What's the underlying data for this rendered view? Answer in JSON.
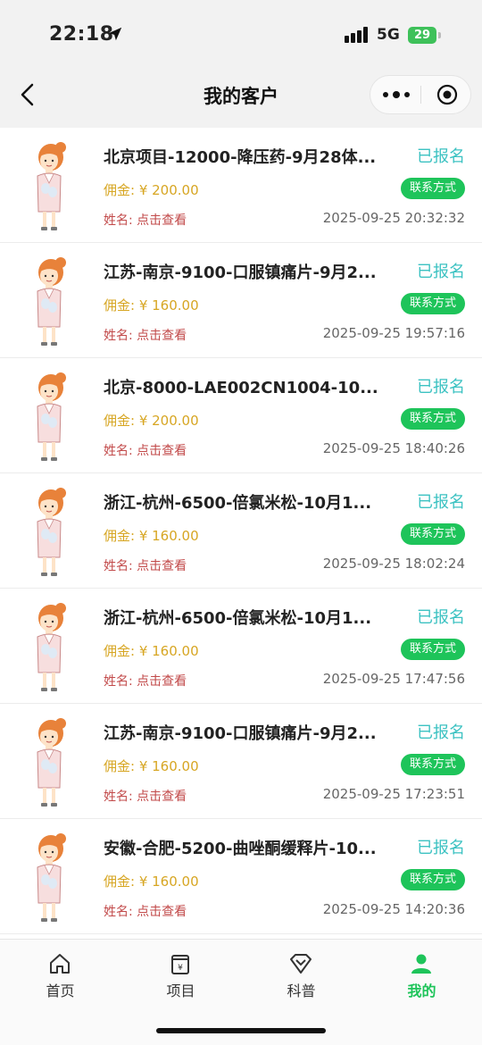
{
  "status_bar": {
    "time": "22:18",
    "network": "5G",
    "battery": "29"
  },
  "nav": {
    "title": "我的客户"
  },
  "commission_prefix": "佣金: ",
  "name_prefix": "姓名: ",
  "items": [
    {
      "title": "北京项目-12000-降压药-9月28体...",
      "status": "已报名",
      "commission": "¥ 200.00",
      "contact": "联系方式",
      "name": "点击查看",
      "time": "2025-09-25 20:32:32"
    },
    {
      "title": "江苏-南京-9100-口服镇痛片-9月2...",
      "status": "已报名",
      "commission": "¥ 160.00",
      "contact": "联系方式",
      "name": "点击查看",
      "time": "2025-09-25 19:57:16"
    },
    {
      "title": "北京-8000-LAE002CN1004-10...",
      "status": "已报名",
      "commission": "¥ 200.00",
      "contact": "联系方式",
      "name": "点击查看",
      "time": "2025-09-25 18:40:26"
    },
    {
      "title": "浙江-杭州-6500-倍氯米松-10月1...",
      "status": "已报名",
      "commission": "¥ 160.00",
      "contact": "联系方式",
      "name": "点击查看",
      "time": "2025-09-25 18:02:24"
    },
    {
      "title": "浙江-杭州-6500-倍氯米松-10月1...",
      "status": "已报名",
      "commission": "¥ 160.00",
      "contact": "联系方式",
      "name": "点击查看",
      "time": "2025-09-25 17:47:56"
    },
    {
      "title": "江苏-南京-9100-口服镇痛片-9月2...",
      "status": "已报名",
      "commission": "¥ 160.00",
      "contact": "联系方式",
      "name": "点击查看",
      "time": "2025-09-25 17:23:51"
    },
    {
      "title": "安徽-合肥-5200-曲唑酮缓释片-10...",
      "status": "已报名",
      "commission": "¥ 160.00",
      "contact": "联系方式",
      "name": "点击查看",
      "time": "2025-09-25 14:20:36"
    }
  ],
  "tabs": [
    {
      "label": "首页",
      "icon": "home-icon"
    },
    {
      "label": "项目",
      "icon": "project-icon"
    },
    {
      "label": "科普",
      "icon": "science-icon"
    },
    {
      "label": "我的",
      "icon": "user-icon",
      "active": true
    }
  ],
  "colors": {
    "accent": "#1ec45a",
    "status": "#3cc2c2",
    "commission": "#d7a623",
    "name_label": "#c24a4a"
  }
}
